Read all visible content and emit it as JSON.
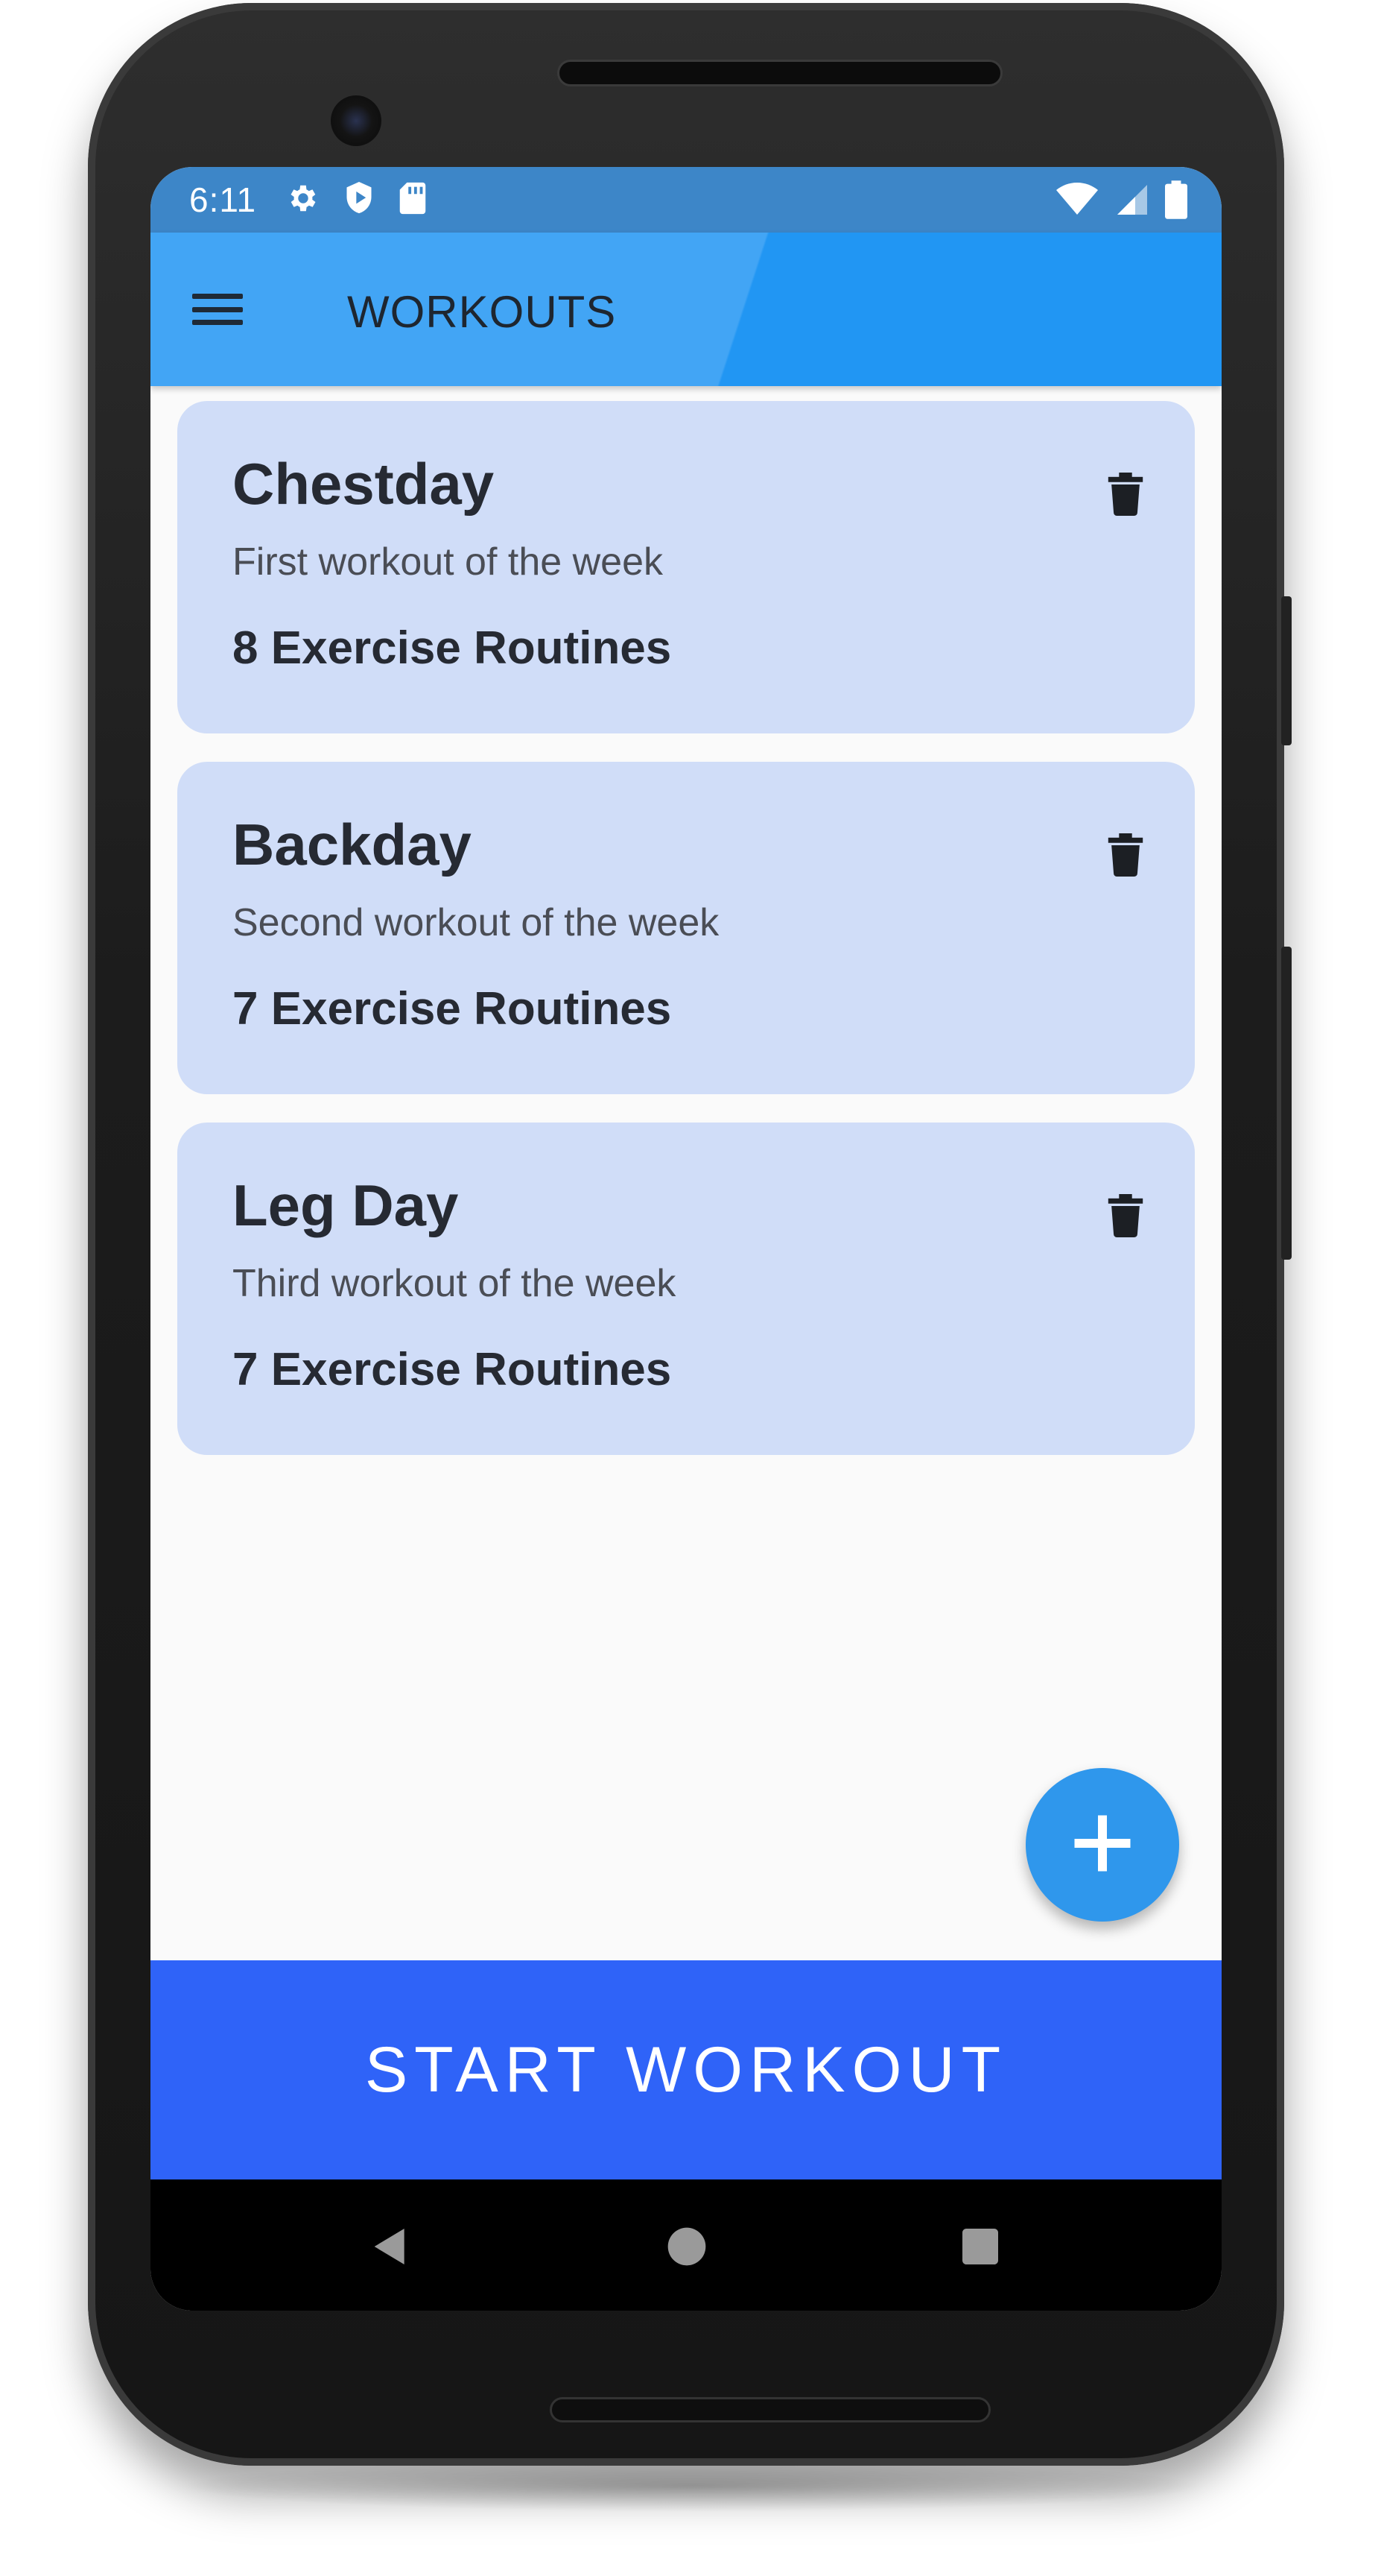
{
  "status_bar": {
    "time": "6:11"
  },
  "app_bar": {
    "title": "WORKOUTS"
  },
  "workouts": [
    {
      "title": "Chestday",
      "subtitle": "First workout of the week",
      "routines": "8 Exercise Routines"
    },
    {
      "title": "Backday",
      "subtitle": "Second workout of the week",
      "routines": "7 Exercise Routines"
    },
    {
      "title": "Leg Day",
      "subtitle": "Third workout of the week",
      "routines": "7 Exercise Routines"
    }
  ],
  "start_button": {
    "label": "START WORKOUT"
  },
  "icons": {
    "menu": "hamburger-menu-icon",
    "delete": "trash-icon",
    "add": "plus-icon",
    "nav_back": "back-triangle-icon",
    "nav_home": "home-circle-icon",
    "nav_recents": "recents-square-icon"
  },
  "colors": {
    "status_bar": "#3d86c8",
    "app_bar_light": "#42a5f5",
    "app_bar_dark": "#2196f3",
    "card_background": "#d0ddf8",
    "fab": "#2f97ec",
    "start_button": "#2f63f8"
  }
}
